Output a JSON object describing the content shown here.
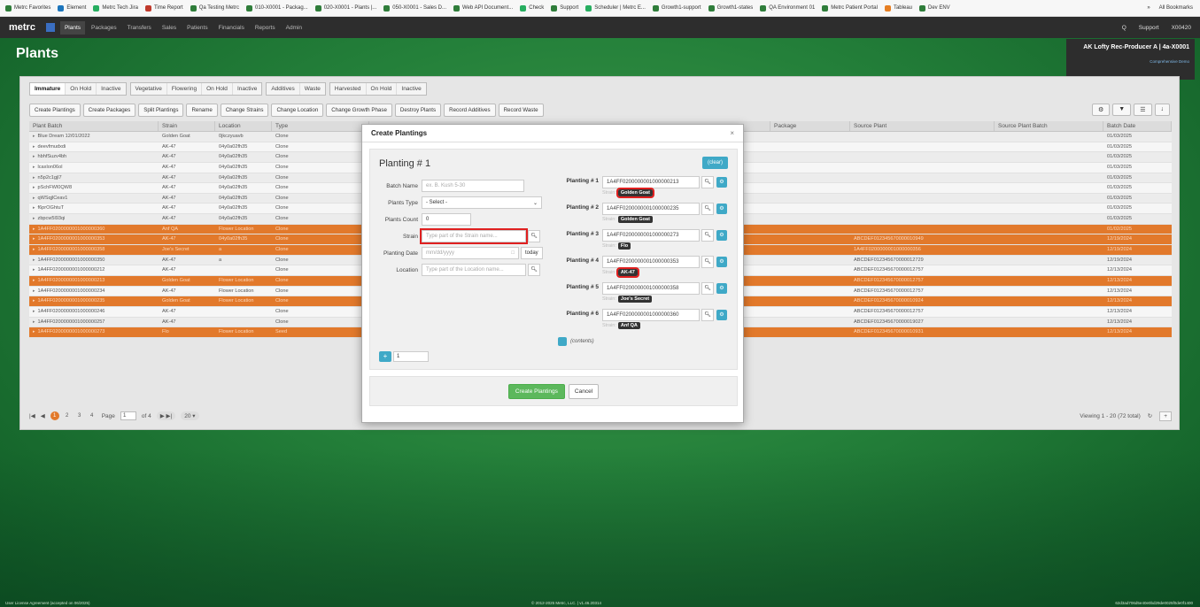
{
  "bookmarks": {
    "items": [
      "Metrc Favorites",
      "Element",
      "Metrc Tech Jira",
      "Time Report",
      "Qa Testing Metrc",
      "010-X0001 - Packag...",
      "020-X0001 - Plants |...",
      "050-X0001 - Sales D...",
      "Web API Document...",
      "Check",
      "Support",
      "Scheduler | Metrc E...",
      "Growth1-support",
      "Growth1-states",
      "QA Environment 01",
      "Metrc Patient Portal",
      "Tableau",
      "Dev ENV"
    ],
    "more": "»",
    "all": "All Bookmarks"
  },
  "nav": {
    "logo": "metrc",
    "menus": [
      "Plants",
      "Packages",
      "Transfers",
      "Sales",
      "Patients",
      "Financials",
      "Reports",
      "Admin"
    ],
    "right": [
      "Q",
      "Support",
      "X00420"
    ]
  },
  "page": {
    "title": "Plants",
    "facility": "AK Lofty Rec-Producer A | 4a-X0001",
    "facility_sub": "Comprehensive Demo"
  },
  "tabs": [
    [
      "Immature",
      "On Hold",
      "Inactive"
    ],
    [
      "Vegetative",
      "Flowering",
      "On Hold",
      "Inactive"
    ],
    [
      "Additives",
      "Waste"
    ],
    [
      "Harvested",
      "On Hold",
      "Inactive"
    ]
  ],
  "actions": [
    "Create Plantings",
    "Create Packages",
    "Split Plantings",
    "Rename",
    "Change Strains",
    "Change Location",
    "Change Growth Phase",
    "Destroy Plants",
    "Record Additives",
    "Record Waste"
  ],
  "tools": [
    "⚙",
    "▼",
    "☰",
    "↓"
  ],
  "grid": {
    "headers": [
      "Plant Batch",
      "Strain",
      "Location",
      "Type",
      "",
      "Package",
      "Source Plant",
      "Source Plant Batch",
      "Batch Date"
    ],
    "rows": [
      {
        "sel": false,
        "c": [
          "Blue Dream 12/01/2022",
          "Golden Goat",
          "0jkczyuavb",
          "Clone",
          "",
          "",
          "",
          "01/03/2025"
        ]
      },
      {
        "sel": false,
        "c": [
          "deevfmudxdi",
          "AK-47",
          "04y0a02fh35",
          "Clone",
          "",
          "",
          "",
          "01/03/2025"
        ]
      },
      {
        "sel": false,
        "c": [
          "hbhfSuzv4bh",
          "AK-47",
          "04y0a02fh35",
          "Clone",
          "",
          "",
          "",
          "01/03/2025"
        ]
      },
      {
        "sel": false,
        "c": [
          "lcaxlon06ol",
          "AK-47",
          "04y0a02fh35",
          "Clone",
          "",
          "",
          "",
          "01/03/2025"
        ]
      },
      {
        "sel": false,
        "c": [
          "n5p2c1gjl7",
          "AK-47",
          "04y0a02fh35",
          "Clone",
          "",
          "",
          "",
          "01/03/2025"
        ]
      },
      {
        "sel": false,
        "c": [
          "pSchFWl0QW8",
          "AK-47",
          "04y0a02fh35",
          "Clone",
          "",
          "",
          "",
          "01/03/2025"
        ]
      },
      {
        "sel": false,
        "c": [
          "qWSqjlCeav1",
          "AK-47",
          "04y0a02fh35",
          "Clone",
          "",
          "",
          "",
          "01/03/2025"
        ]
      },
      {
        "sel": false,
        "c": [
          "f6prOGhtuT",
          "AK-47",
          "04y0a02fh35",
          "Clone",
          "",
          "",
          "",
          "01/03/2025"
        ]
      },
      {
        "sel": false,
        "c": [
          "zbpcw5l93qi",
          "AK-47",
          "04y0a02fh35",
          "Clone",
          "",
          "",
          "",
          "01/03/2025"
        ]
      },
      {
        "sel": true,
        "c": [
          "1A4FF0200000001000000360",
          "Anf QA",
          "Flower Location",
          "Clone",
          "",
          "",
          "",
          "01/02/2025"
        ]
      },
      {
        "sel": true,
        "c": [
          "1A4FF0200000001000000353",
          "AK-47",
          "04y0a02fh35",
          "Clone",
          "",
          "ABCDEF012345670000010949",
          "",
          "12/19/2024"
        ]
      },
      {
        "sel": true,
        "c": [
          "1A4FF0200000001000000358",
          "Joe's Secret",
          "a",
          "Clone",
          "",
          "1A4FF0200000001000000356",
          "",
          "12/19/2024"
        ]
      },
      {
        "sel": false,
        "c": [
          "1A4FF0200000001000000350",
          "AK-47",
          "a",
          "Clone",
          "",
          "ABCDEF012345670000012729",
          "",
          "12/19/2024"
        ]
      },
      {
        "sel": false,
        "c": [
          "1A4FF0200000001000000212",
          "AK-47",
          "",
          "Clone",
          "",
          "ABCDEF012345670000012757",
          "",
          "12/13/2024"
        ]
      },
      {
        "sel": true,
        "c": [
          "1A4FF0200000001000000213",
          "Golden Goat",
          "Flower Location",
          "Clone",
          "",
          "ABCDEF012345670000012757",
          "",
          "12/13/2024"
        ]
      },
      {
        "sel": false,
        "c": [
          "1A4FF0200000001000000234",
          "AK-47",
          "Flower Location",
          "Clone",
          "",
          "ABCDEF012345670000012757",
          "",
          "12/13/2024"
        ]
      },
      {
        "sel": true,
        "c": [
          "1A4FF0200000001000000235",
          "Golden Goat",
          "Flower Location",
          "Clone",
          "",
          "ABCDEF012345670000010924",
          "",
          "12/13/2024"
        ]
      },
      {
        "sel": false,
        "c": [
          "1A4FF0200000001000000246",
          "AK-47",
          "",
          "Clone",
          "",
          "ABCDEF012345670000012757",
          "",
          "12/13/2024"
        ]
      },
      {
        "sel": false,
        "c": [
          "1A4FF0200000001000000257",
          "AK-47",
          "",
          "Clone",
          "",
          "ABCDEF012345670000019027",
          "",
          "12/13/2024"
        ]
      },
      {
        "sel": true,
        "c": [
          "1A4FF0200000001000000273",
          "Flo",
          "Flower Location",
          "Seed",
          "",
          "ABCDEF012345670000010931",
          "",
          "12/13/2024"
        ]
      }
    ]
  },
  "pager": {
    "pages": [
      "1",
      "2",
      "3",
      "4"
    ],
    "page_label": "Page",
    "page_value": "1",
    "of": "of 4",
    "size": "20",
    "viewing": "Viewing 1 - 20 (72 total)"
  },
  "modal": {
    "title": "Create Plantings",
    "close": "×",
    "planting_title": "Planting # 1",
    "clear": "(clear)",
    "fields": {
      "batch_name_label": "Batch Name",
      "batch_name_placeholder": "ex. B. Kush 5-30",
      "plants_type_label": "Plants Type",
      "plants_type_value": "- Select -",
      "plants_count_label": "Plants Count",
      "plants_count_value": "0",
      "strain_label": "Strain",
      "strain_placeholder": "Type part of the Strain name...",
      "planting_date_label": "Planting Date",
      "planting_date_placeholder": "mm/dd/yyyy",
      "today": "today",
      "location_label": "Location",
      "location_placeholder": "Type part of the Location name..."
    },
    "plantings": [
      {
        "label": "Planting # 1",
        "tag": "1A4FF0200000001000000213",
        "strain_prefix": "Strain:",
        "strain": "Golden Goat"
      },
      {
        "label": "Planting # 2",
        "tag": "1A4FF0200000001000000235",
        "strain_prefix": "Strain:",
        "strain": "Golden Goat"
      },
      {
        "label": "Planting # 3",
        "tag": "1A4FF0200000001000000273",
        "strain_prefix": "Strain:",
        "strain": "Flo"
      },
      {
        "label": "Planting # 4",
        "tag": "1A4FF0200000001000000353",
        "strain_prefix": "Strain:",
        "strain": "AK-47"
      },
      {
        "label": "Planting # 5",
        "tag": "1A4FF0200000001000000358",
        "strain_prefix": "Strain:",
        "strain": "Joe's Secret"
      },
      {
        "label": "Planting # 6",
        "tag": "1A4FF0200000001000000360",
        "strain_prefix": "Strain:",
        "strain": "Anf QA"
      }
    ],
    "contents": "(contents)",
    "add_count": "1",
    "create_button": "Create Plantings",
    "cancel_button": "Cancel"
  },
  "footer": {
    "left": "User License Agreement (accepted on 06/2025)",
    "center": "© 2012-2025 Metrc, LLC. | v1.46.20314",
    "right": "62d3ad706d5e40e0bd29de0025f0de0f1400"
  },
  "colors": {
    "selected_row": "#e2792b",
    "accent": "#3fa9c7",
    "create_green": "#5cb85c",
    "highlight_red": "#e02020"
  }
}
